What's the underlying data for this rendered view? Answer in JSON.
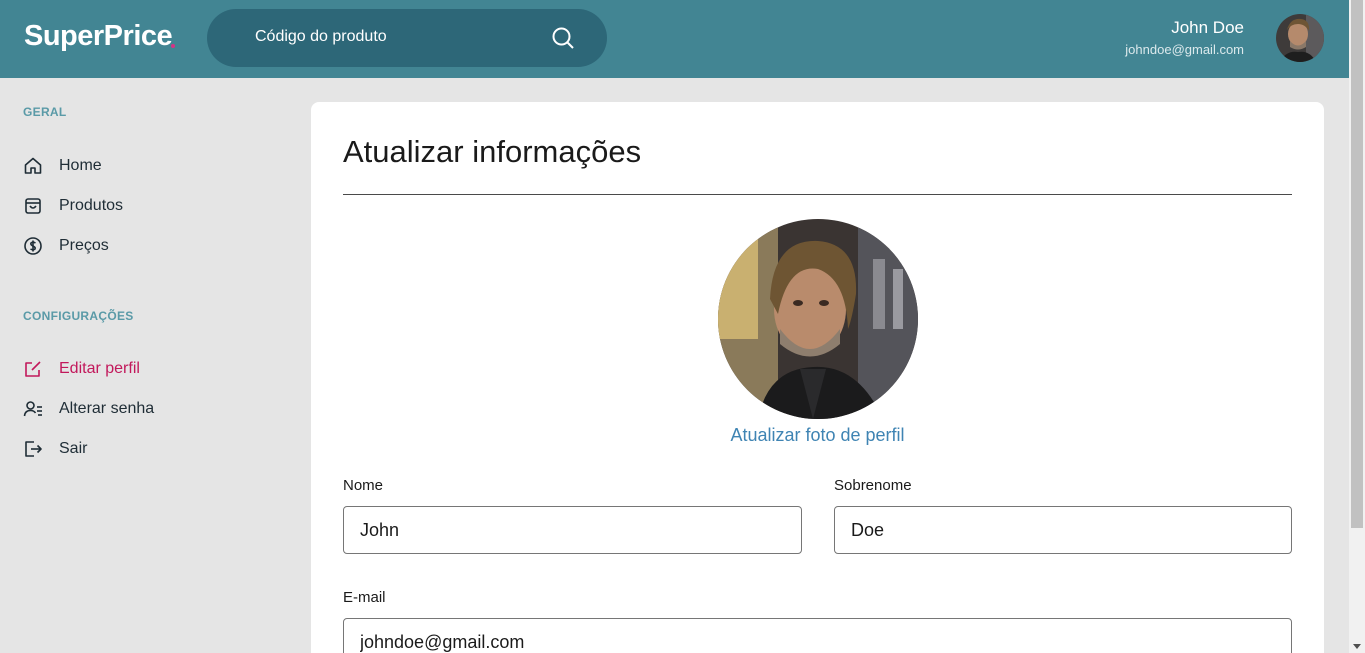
{
  "header": {
    "logo": "SuperPrice",
    "search_placeholder": "Código do produto",
    "user_name": "John Doe",
    "user_email": "johndoe@gmail.com"
  },
  "sidebar": {
    "section_general": "GERAL",
    "items_general": [
      {
        "label": "Home",
        "icon": "home-icon"
      },
      {
        "label": "Produtos",
        "icon": "shopping-bag-icon"
      },
      {
        "label": "Preços",
        "icon": "dollar-circle-icon"
      }
    ],
    "section_settings": "CONFIGURAÇÕES",
    "items_settings": [
      {
        "label": "Editar perfil",
        "icon": "edit-icon",
        "active": true
      },
      {
        "label": "Alterar senha",
        "icon": "user-lock-icon"
      },
      {
        "label": "Sair",
        "icon": "logout-icon"
      }
    ]
  },
  "main": {
    "title": "Atualizar informações",
    "photo_link": "Atualizar foto de perfil",
    "fields": {
      "first_name_label": "Nome",
      "first_name_value": "John",
      "last_name_label": "Sobrenome",
      "last_name_value": "Doe",
      "email_label": "E-mail",
      "email_value": "johndoe@gmail.com"
    }
  },
  "colors": {
    "header_bg": "#428593",
    "search_bg": "#2d6778",
    "accent_pink": "#c2185b",
    "link_blue": "#3f84b3",
    "section_title": "#5a9aa7"
  }
}
